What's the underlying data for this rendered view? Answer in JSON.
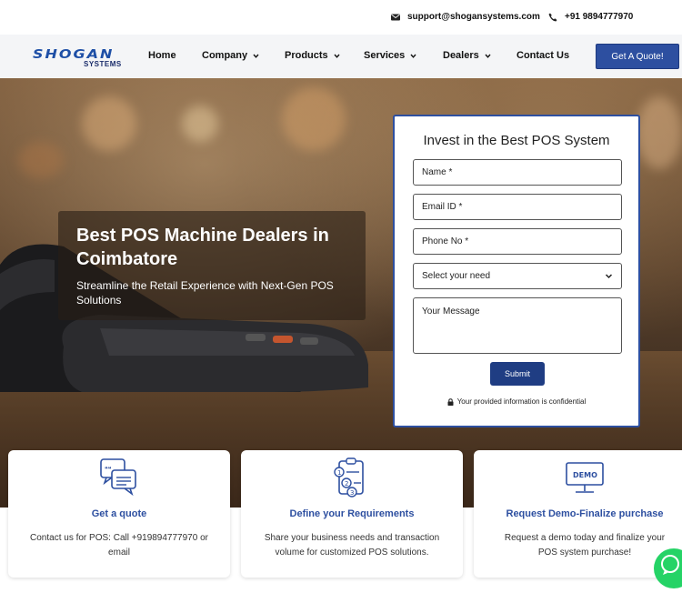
{
  "topbar": {
    "email": "support@shogansystems.com",
    "phone": "+91 9894777970"
  },
  "nav": {
    "logo_brand": "SHOGAN",
    "logo_sub": "SYSTEMS",
    "links": [
      "Home",
      "Company",
      "Products",
      "Services",
      "Dealers",
      "Contact Us"
    ],
    "cta": "Get A Quote!"
  },
  "hero": {
    "title": "Best POS Machine Dealers in Coimbatore",
    "subtitle": "Streamline the Retail Experience with Next-Gen POS Solutions"
  },
  "form": {
    "title": "Invest in the Best POS System",
    "name_placeholder": "Name *",
    "email_placeholder": "Email ID *",
    "phone_placeholder": "Phone No *",
    "select_value": "Select your need",
    "message_placeholder": "Your Message",
    "submit": "Submit",
    "note": "Your provided information is confidential"
  },
  "cards": [
    {
      "title": "Get a quote",
      "desc": "Contact us for POS: Call +919894777970 or email",
      "icon": "chat-bubbles-icon"
    },
    {
      "title": "Define your Requirements",
      "desc": "Share your business needs and transaction volume for customized POS solutions.",
      "icon": "checklist-icon"
    },
    {
      "title": "Request Demo-Finalize purchase",
      "desc": "Request a demo today and finalize your POS system purchase!",
      "icon": "demo-screen-icon"
    }
  ],
  "colors": {
    "primary": "#2d4fa0",
    "dark_primary": "#1f3d83",
    "whatsapp": "#25d366"
  }
}
